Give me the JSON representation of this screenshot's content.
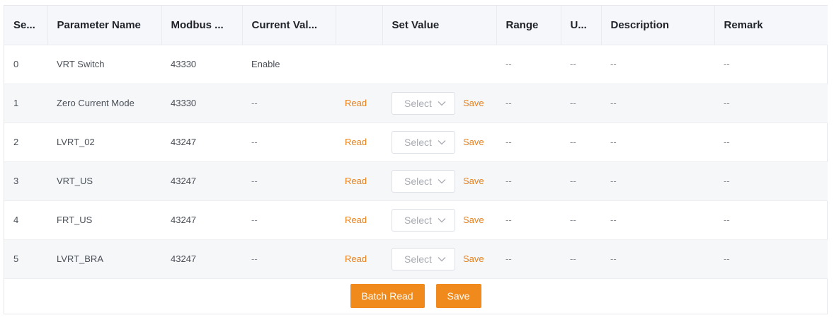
{
  "table": {
    "headers": {
      "seq": "Se...",
      "name": "Parameter Name",
      "addr": "Modbus ...",
      "current": "Current Val...",
      "read": "",
      "set": "Set Value",
      "range": "Range",
      "unit": "U...",
      "description": "Description",
      "remark": "Remark"
    },
    "rows": [
      {
        "seq": "0",
        "name": "VRT Switch",
        "addr": "43330",
        "current": "Enable",
        "read": "",
        "select": "",
        "save": "",
        "range": "--",
        "unit": "--",
        "description": "--",
        "remark": "--"
      },
      {
        "seq": "1",
        "name": "Zero Current Mode",
        "addr": "43330",
        "current": "--",
        "read": "Read",
        "select": "Select",
        "save": "Save",
        "range": "--",
        "unit": "--",
        "description": "--",
        "remark": "--"
      },
      {
        "seq": "2",
        "name": "LVRT_02",
        "addr": "43247",
        "current": "--",
        "read": "Read",
        "select": "Select",
        "save": "Save",
        "range": "--",
        "unit": "--",
        "description": "--",
        "remark": "--"
      },
      {
        "seq": "3",
        "name": "VRT_US",
        "addr": "43247",
        "current": "--",
        "read": "Read",
        "select": "Select",
        "save": "Save",
        "range": "--",
        "unit": "--",
        "description": "--",
        "remark": "--"
      },
      {
        "seq": "4",
        "name": "FRT_US",
        "addr": "43247",
        "current": "--",
        "read": "Read",
        "select": "Select",
        "save": "Save",
        "range": "--",
        "unit": "--",
        "description": "--",
        "remark": "--"
      },
      {
        "seq": "5",
        "name": "LVRT_BRA",
        "addr": "43247",
        "current": "--",
        "read": "Read",
        "select": "Select",
        "save": "Save",
        "range": "--",
        "unit": "--",
        "description": "--",
        "remark": "--"
      }
    ]
  },
  "footer": {
    "batch_read_label": "Batch Read",
    "save_label": "Save"
  },
  "colors": {
    "accent": "#f08a1c",
    "link": "#e8821e",
    "header_bg": "#f5f7fa",
    "stripe_bg": "#f6f7f9"
  },
  "icons": {
    "select_chevron": "chevron-down-icon"
  }
}
